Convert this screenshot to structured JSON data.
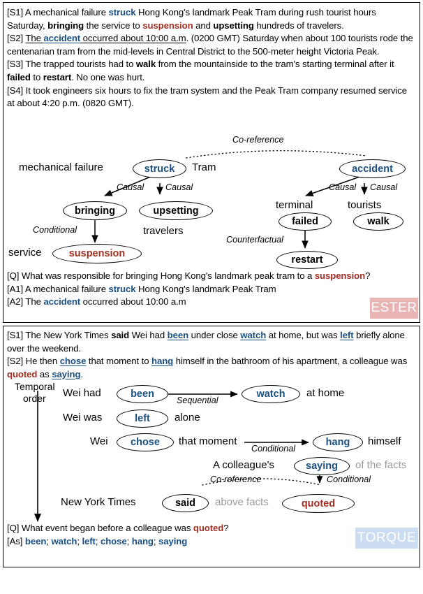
{
  "colors": {
    "event_blue": "#1b4f82",
    "answer_red": "#a32f22",
    "faded_grey": "#9a9a9a",
    "ester_badge_bg": "#e9b4b4",
    "torque_badge_bg": "#ccddf1"
  },
  "ester": {
    "badge_label": "ESTER",
    "sentences": [
      {
        "id": "[S1]",
        "parts": [
          {
            "t": "A mechanical failure ",
            "style": "plain"
          },
          {
            "t": "struck",
            "style": "blue"
          },
          {
            "t": " Hong Kong's landmark Peak Tram during rush tourist hours Saturday, ",
            "style": "plain"
          },
          {
            "t": "bringing",
            "style": "bold"
          },
          {
            "t": " the service to ",
            "style": "plain"
          },
          {
            "t": "suspension",
            "style": "red"
          },
          {
            "t": " and ",
            "style": "plain"
          },
          {
            "t": "upsetting",
            "style": "bold"
          },
          {
            "t": " hundreds of travelers.",
            "style": "plain"
          }
        ]
      },
      {
        "id": "[S2]",
        "parts": [
          {
            "t": "The ",
            "style": "underline"
          },
          {
            "t": "accident",
            "style": "blue-underline"
          },
          {
            "t": " occurred about 10:00 a.m",
            "style": "underline"
          },
          {
            "t": ". (0200 GMT) Saturday when about 100 tourists rode the centenarian tram from the mid-levels in Central District to the 500-meter height Victoria Peak.",
            "style": "plain"
          }
        ]
      },
      {
        "id": "[S3]",
        "parts": [
          {
            "t": "The trapped tourists had to ",
            "style": "plain"
          },
          {
            "t": "walk",
            "style": "bold"
          },
          {
            "t": " from the mountainside to the tram's starting terminal after it ",
            "style": "plain"
          },
          {
            "t": "failed",
            "style": "bold"
          },
          {
            "t": " to ",
            "style": "plain"
          },
          {
            "t": "restart",
            "style": "bold"
          },
          {
            "t": ". No one was hurt.",
            "style": "plain"
          }
        ]
      },
      {
        "id": "[S4]",
        "parts": [
          {
            "t": "It took engineers six hours to fix the tram system and the Peak Tram company resumed service at about 4:20 p.m. (0820 GMT).",
            "style": "plain"
          }
        ]
      }
    ],
    "graph": {
      "nodes": [
        {
          "name": "struck",
          "label": "struck",
          "color": "blue"
        },
        {
          "name": "accident",
          "label": "accident",
          "color": "blue"
        },
        {
          "name": "bringing",
          "label": "bringing",
          "color": "black"
        },
        {
          "name": "upsetting",
          "label": "upsetting",
          "color": "black"
        },
        {
          "name": "failed",
          "label": "failed",
          "color": "black"
        },
        {
          "name": "walk",
          "label": "walk",
          "color": "black"
        },
        {
          "name": "suspension",
          "label": "suspension",
          "color": "red"
        },
        {
          "name": "restart",
          "label": "restart",
          "color": "black"
        }
      ],
      "context_words": [
        {
          "name": "mechanical-failure",
          "label": "mechanical failure"
        },
        {
          "name": "tram",
          "label": "Tram"
        },
        {
          "name": "travelers",
          "label": "travelers"
        },
        {
          "name": "terminal",
          "label": "terminal"
        },
        {
          "name": "tourists",
          "label": "tourists"
        },
        {
          "name": "service",
          "label": "service"
        }
      ],
      "edge_labels": {
        "coreference": "Co-reference",
        "causal_1": "Causal",
        "causal_2": "Causal",
        "causal_3": "Causal",
        "causal_4": "Causal",
        "conditional": "Conditional",
        "counterfactual": "Counterfactual"
      }
    },
    "qa": {
      "question_id": "[Q]",
      "question_before": "What was responsible for bringing Hong Kong's landmark peak tram to a ",
      "question_highlight": "suspension",
      "question_after": "?",
      "answers": [
        {
          "id": "[A1]",
          "before": "A mechanical failure ",
          "highlight": "struck",
          "after": " Hong Kong's landmark Peak Tram"
        },
        {
          "id": "[A2]",
          "before": "The ",
          "highlight": "accident",
          "after": " occurred about 10:00 a.m"
        }
      ]
    }
  },
  "torque": {
    "badge_label": "TORQUE",
    "sentences": [
      {
        "id": "[S1]",
        "parts": [
          {
            "t": "The New York Times ",
            "style": "plain"
          },
          {
            "t": "said",
            "style": "bold"
          },
          {
            "t": " Wei had ",
            "style": "plain"
          },
          {
            "t": "been",
            "style": "blue-underline"
          },
          {
            "t": " under close ",
            "style": "plain"
          },
          {
            "t": "watch",
            "style": "blue-underline"
          },
          {
            "t": " at home, but was ",
            "style": "plain"
          },
          {
            "t": "left",
            "style": "blue-underline"
          },
          {
            "t": " briefly alone over the weekend.",
            "style": "plain"
          }
        ]
      },
      {
        "id": "[S2]",
        "parts": [
          {
            "t": "He then ",
            "style": "plain"
          },
          {
            "t": "chose",
            "style": "blue-underline"
          },
          {
            "t": " that moment to ",
            "style": "plain"
          },
          {
            "t": "hang",
            "style": "blue-underline"
          },
          {
            "t": " himself in the bathroom of his apartment, a colleague was ",
            "style": "plain"
          },
          {
            "t": "quoted",
            "style": "red"
          },
          {
            "t": " as ",
            "style": "plain"
          },
          {
            "t": "saying",
            "style": "blue-underline"
          },
          {
            "t": ".",
            "style": "plain"
          }
        ]
      }
    ],
    "graph": {
      "axis_label_line1": "Temporal",
      "axis_label_line2": "order",
      "nodes": [
        {
          "name": "been",
          "label": "been",
          "color": "blue"
        },
        {
          "name": "watch",
          "label": "watch",
          "color": "blue"
        },
        {
          "name": "left",
          "label": "left",
          "color": "blue"
        },
        {
          "name": "chose",
          "label": "chose",
          "color": "blue"
        },
        {
          "name": "hang",
          "label": "hang",
          "color": "blue"
        },
        {
          "name": "saying",
          "label": "saying",
          "color": "blue"
        },
        {
          "name": "said",
          "label": "said",
          "color": "black"
        },
        {
          "name": "quoted",
          "label": "quoted",
          "color": "red"
        }
      ],
      "context_words": [
        {
          "name": "wei-had",
          "label": "Wei had",
          "faded": false
        },
        {
          "name": "at-home",
          "label": "at home",
          "faded": false
        },
        {
          "name": "wei-was",
          "label": "Wei was",
          "faded": false
        },
        {
          "name": "alone",
          "label": "alone",
          "faded": false
        },
        {
          "name": "wei",
          "label": "Wei",
          "faded": false
        },
        {
          "name": "that-moment",
          "label": "that moment",
          "faded": false
        },
        {
          "name": "himself",
          "label": "himself",
          "faded": false
        },
        {
          "name": "a-colleagues",
          "label": "A colleague's",
          "faded": false
        },
        {
          "name": "of-the-facts",
          "label": "of the facts",
          "faded": true
        },
        {
          "name": "new-york-times",
          "label": "New York Times",
          "faded": false
        },
        {
          "name": "above-facts",
          "label": "above facts",
          "faded": true
        }
      ],
      "edge_labels": {
        "sequential": "Sequential",
        "conditional_1": "Conditional",
        "coreference": "Co-reference",
        "conditional_2": "Conditional"
      }
    },
    "qa": {
      "question_id": "[Q]",
      "question_before": "What event began before a colleague was ",
      "question_highlight": "quoted",
      "question_after": "?",
      "answers_id": "[As]",
      "answers_list": [
        "been",
        "watch",
        "left",
        "chose",
        "hang",
        "saying"
      ],
      "answers_separator": "; "
    }
  }
}
